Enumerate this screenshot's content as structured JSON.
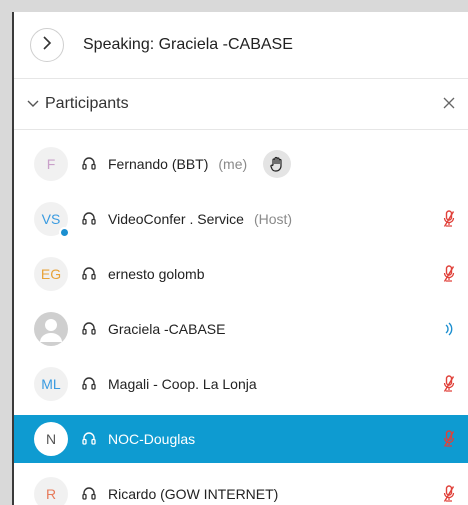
{
  "speaking": {
    "text": "Speaking: Graciela -CABASE"
  },
  "participants": {
    "title": "Participants",
    "rows": [
      {
        "initials": "F",
        "initials_color": "#c9a0c9",
        "name": "Fernando (BBT)",
        "tag": "(me)",
        "right_icon": "raise-hand-icon"
      },
      {
        "initials": "VS",
        "initials_color": "#3a9be0",
        "name": "VideoConfer . Service",
        "tag": "(Host)",
        "right_icon": "mic-muted-icon"
      },
      {
        "initials": "EG",
        "initials_color": "#e8a33a",
        "name": "ernesto golomb",
        "tag": "",
        "right_icon": "mic-muted-icon"
      },
      {
        "initials": "",
        "initials_color": "#9a9a9a",
        "name": "Graciela -CABASE",
        "tag": "",
        "right_icon": "speaking-icon"
      },
      {
        "initials": "ML",
        "initials_color": "#3a9be0",
        "name": "Magali - Coop. La Lonja",
        "tag": "",
        "right_icon": "mic-muted-icon"
      },
      {
        "initials": "N",
        "initials_color": "#555555",
        "name": "NOC-Douglas",
        "tag": "",
        "right_icon": "mic-muted-icon",
        "selected": true
      },
      {
        "initials": "R",
        "initials_color": "#e77a5a",
        "name": "Ricardo (GOW INTERNET)",
        "tag": "",
        "right_icon": "mic-muted-icon"
      }
    ]
  },
  "colors": {
    "muted": "#e0413a",
    "speaking": "#1c8fd0",
    "selected_bg": "#0e9bd1"
  }
}
